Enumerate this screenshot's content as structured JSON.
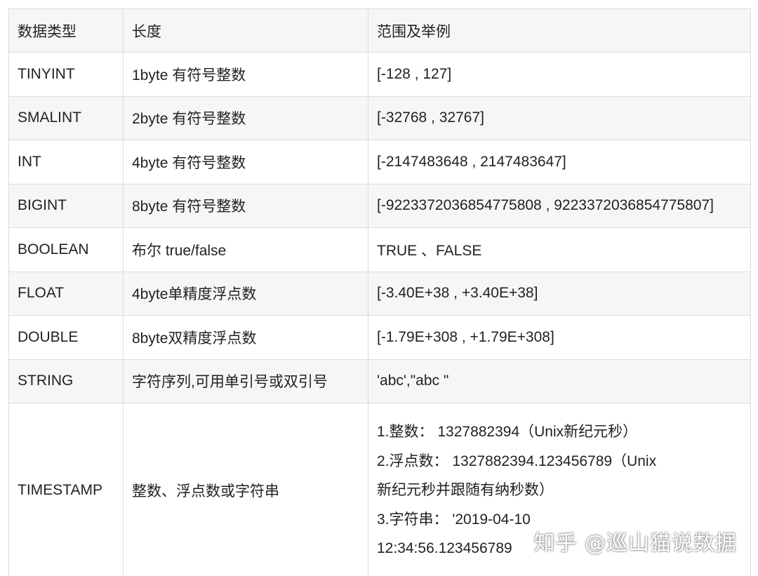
{
  "table": {
    "headers": [
      "数据类型",
      "长度",
      "范围及举例"
    ],
    "rows": [
      {
        "type": "TINYINT",
        "length": "1byte 有符号整数",
        "range": "[-128 , 127]"
      },
      {
        "type": "SMALINT",
        "length": "2byte 有符号整数",
        "range": "[-32768 , 32767]"
      },
      {
        "type": "INT",
        "length": "4byte 有符号整数",
        "range": "[-2147483648 , 2147483647]"
      },
      {
        "type": "BIGINT",
        "length": "8byte 有符号整数",
        "range": "[-9223372036854775808 , 9223372036854775807]"
      },
      {
        "type": "BOOLEAN",
        "length": "布尔 true/false",
        "range": "TRUE 、FALSE"
      },
      {
        "type": "FLOAT",
        "length": "4byte单精度浮点数",
        "range": "[-3.40E+38 , +3.40E+38]"
      },
      {
        "type": "DOUBLE",
        "length": "8byte双精度浮点数",
        "range": "[-1.79E+308 , +1.79E+308]"
      },
      {
        "type": "STRING",
        "length": "字符序列,可用单引号或双引号",
        "range": "'abc',\"abc \""
      },
      {
        "type": "TIMESTAMP",
        "length": "整数、浮点数或字符串",
        "range_lines": [
          "1.整数：    1327882394（Unix新纪元秒）",
          "2.浮点数： 1327882394.123456789（Unix",
          "新纪元秒并跟随有纳秒数）",
          "3.字符串：  '2019-04-10",
          "12:34:56.123456789"
        ]
      }
    ]
  },
  "watermark": "知乎 @巡山猫说数据"
}
